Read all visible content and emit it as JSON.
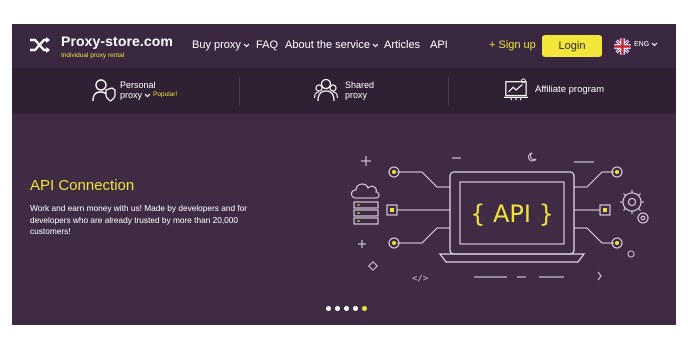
{
  "brand": {
    "name": "Proxy-store.com",
    "tagline": "Individual proxy rental"
  },
  "nav": {
    "items": [
      {
        "label": "Buy proxy",
        "has_dropdown": true
      },
      {
        "label": "FAQ",
        "has_dropdown": false
      },
      {
        "label": "About the service",
        "has_dropdown": true
      },
      {
        "label": "Articles",
        "has_dropdown": false
      },
      {
        "label": "API",
        "has_dropdown": false
      }
    ],
    "signup_label": "+ Sign up",
    "login_label": "Login",
    "language": "ENG"
  },
  "subnav": {
    "personal_line1": "Personal",
    "personal_line2": "proxy",
    "personal_badge": "Popular!",
    "shared_line1": "Shared",
    "shared_line2": "proxy",
    "affiliate": "Affiliate program"
  },
  "hero": {
    "title": "API Connection",
    "text": "Work and earn money with us! Made by developers and for developers who are already trusted by more than 20,000 customers!",
    "screen_text": "{ API }",
    "code_glyph": "</>"
  },
  "slider": {
    "count": 5,
    "active_index": 4
  },
  "colors": {
    "background": "#3f2b43",
    "accent": "#eee13a",
    "nav_bg": "#3a2740",
    "subnav_bg": "#2f2034"
  }
}
